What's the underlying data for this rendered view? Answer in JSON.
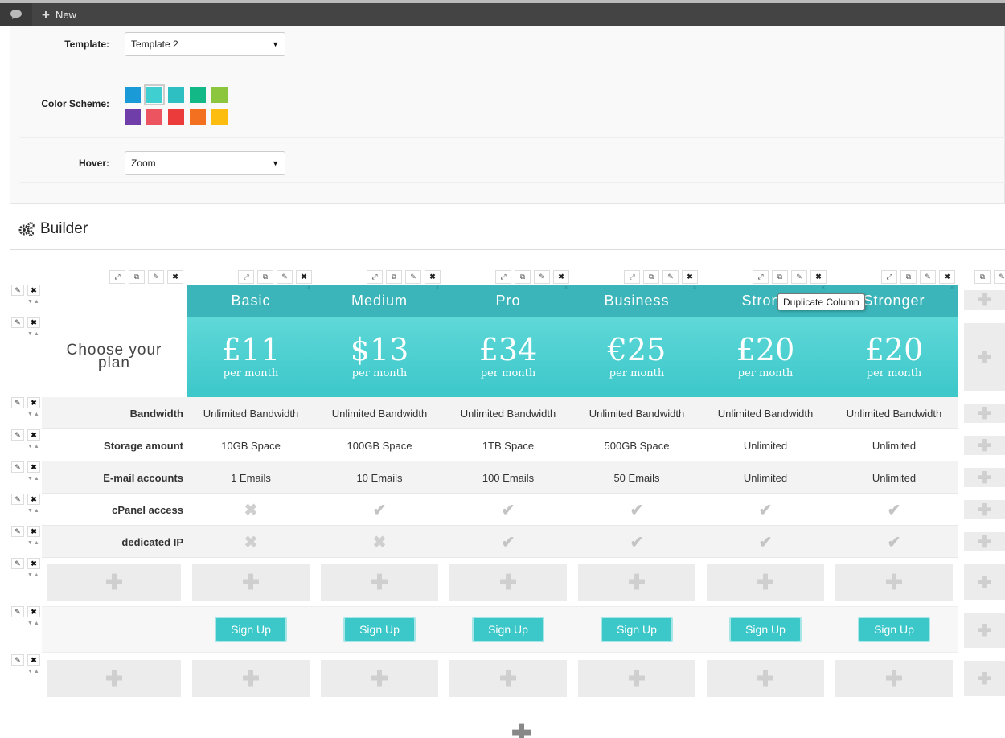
{
  "adminbar": {
    "new_label": "New"
  },
  "settings": {
    "template": {
      "label": "Template:",
      "value": "Template 2"
    },
    "color_scheme": {
      "label": "Color Scheme:",
      "colors": [
        "#1a9ad6",
        "#40cfd0",
        "#2ebfc3",
        "#12b886",
        "#8cc63e",
        "#6f3ea8",
        "#ec5460",
        "#ec3b3b",
        "#f37021",
        "#fdbd10"
      ],
      "selected": "#40cfd0"
    },
    "hover": {
      "label": "Hover:",
      "value": "Zoom"
    }
  },
  "builder": {
    "title": "Builder"
  },
  "table": {
    "choose_label": "Choose your plan",
    "plans": [
      {
        "name": "Basic",
        "price": "£11",
        "period": "per month"
      },
      {
        "name": "Medium",
        "price": "$13",
        "period": "per month"
      },
      {
        "name": "Pro",
        "price": "£34",
        "period": "per month"
      },
      {
        "name": "Business",
        "price": "€25",
        "period": "per month"
      },
      {
        "name": "Strong",
        "price": "£20",
        "period": "per month"
      },
      {
        "name": "Stronger",
        "price": "£20",
        "period": "per month"
      }
    ],
    "features": [
      {
        "label": "Bandwidth",
        "values": [
          "Unlimited Bandwidth",
          "Unlimited Bandwidth",
          "Unlimited Bandwidth",
          "Unlimited Bandwidth",
          "Unlimited Bandwidth",
          "Unlimited Bandwidth"
        ]
      },
      {
        "label": "Storage amount",
        "values": [
          "10GB Space",
          "100GB Space",
          "1TB Space",
          "500GB Space",
          "Unlimited",
          "Unlimited"
        ]
      },
      {
        "label": "E-mail accounts",
        "values": [
          "1 Emails",
          "10 Emails",
          "100 Emails",
          "50 Emails",
          "Unlimited",
          "Unlimited"
        ]
      },
      {
        "label": "cPanel access",
        "values": [
          "cross",
          "check",
          "check",
          "check",
          "check",
          "check"
        ]
      },
      {
        "label": "dedicated IP",
        "values": [
          "cross",
          "cross",
          "check",
          "check",
          "check",
          "check"
        ]
      }
    ],
    "signup_label": "Sign Up"
  },
  "tooltip": {
    "text": "Duplicate Column"
  }
}
